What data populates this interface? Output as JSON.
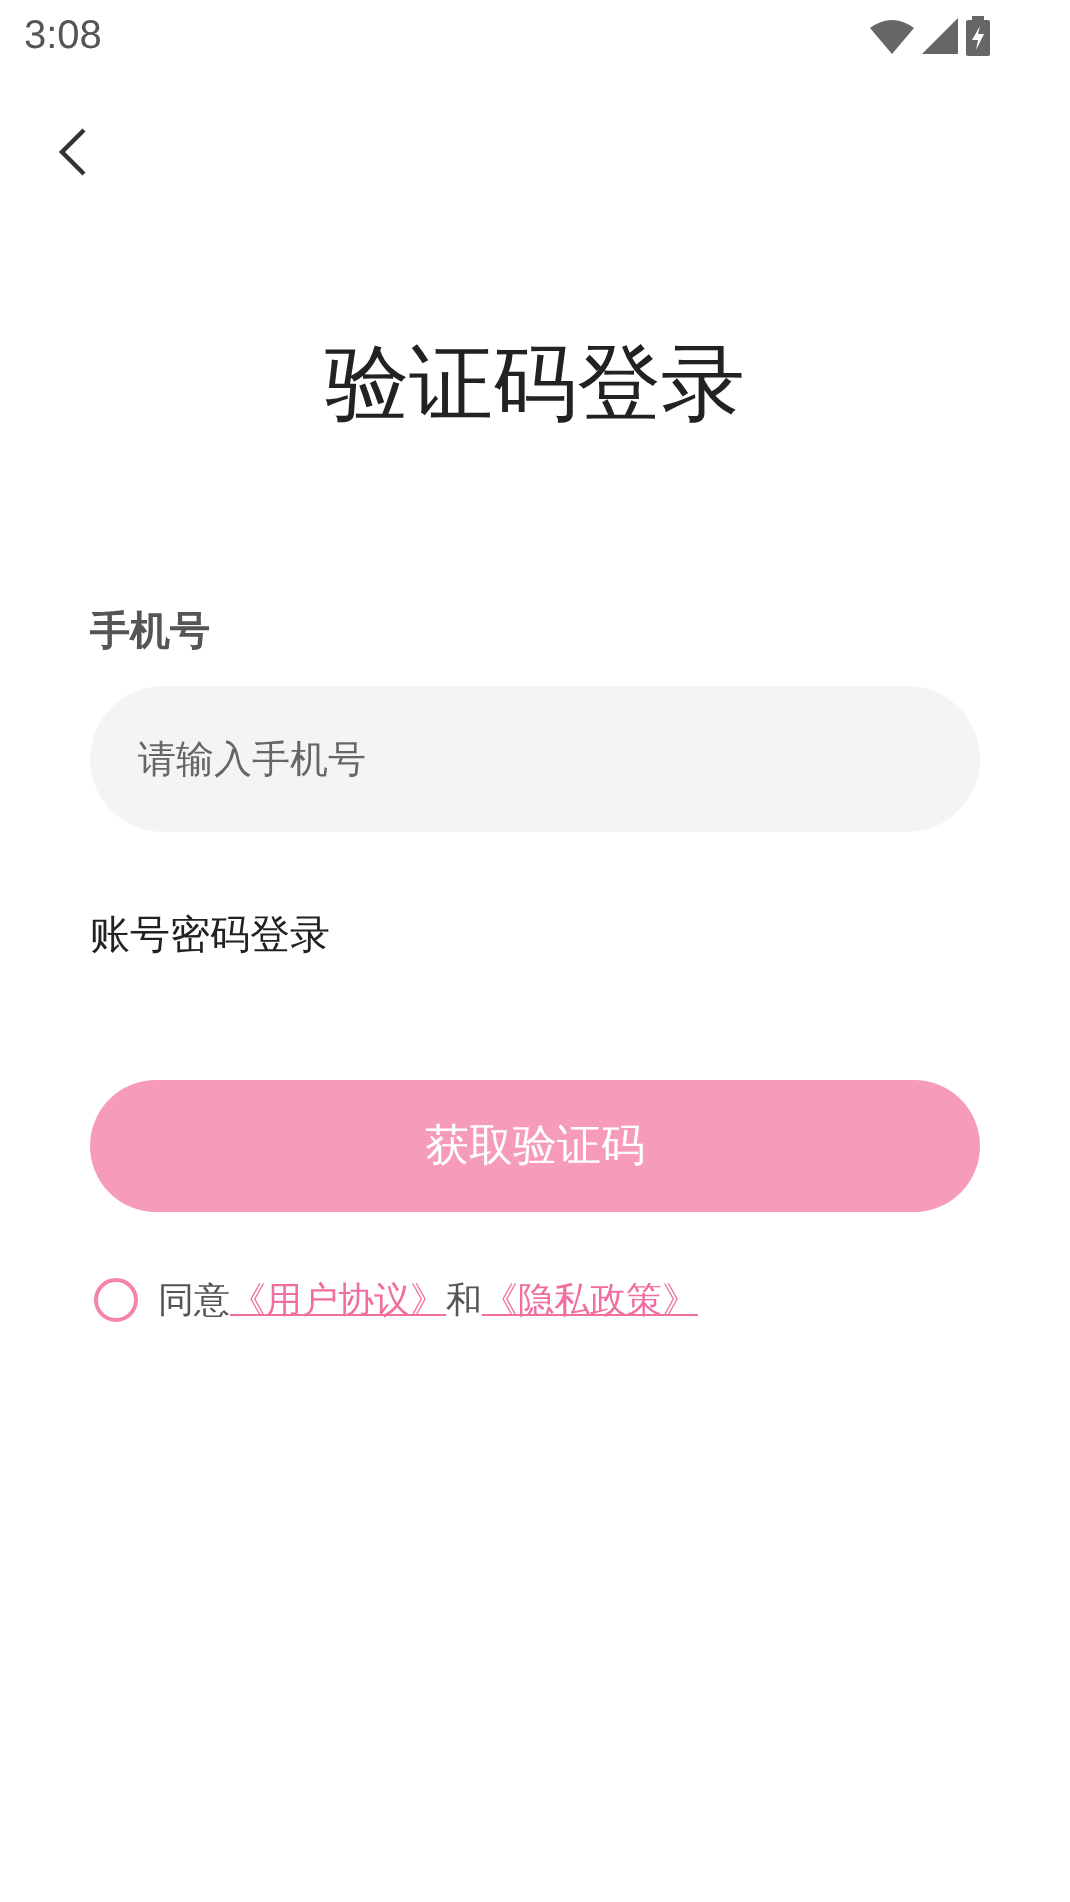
{
  "status_bar": {
    "time": "3:08"
  },
  "title": "验证码登录",
  "phone": {
    "label": "手机号",
    "placeholder": "请输入手机号"
  },
  "password_login": "账号密码登录",
  "submit": {
    "label": "获取验证码",
    "disabled": true
  },
  "agreement": {
    "checked": false,
    "prefix": "同意",
    "link_1": "《用户协议》",
    "joiner": "和",
    "link_2": "《隐私政策》"
  }
}
